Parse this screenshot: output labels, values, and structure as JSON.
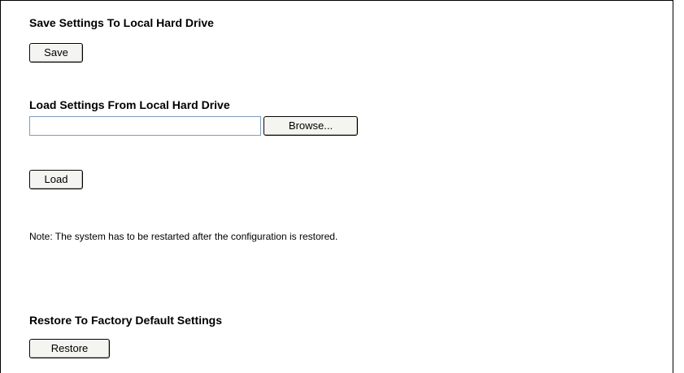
{
  "save_section": {
    "title": "Save Settings To Local Hard Drive",
    "save_button": "Save"
  },
  "load_section": {
    "title": "Load Settings From Local Hard Drive",
    "file_value": "",
    "browse_button": "Browse...",
    "load_button": "Load"
  },
  "note": "Note: The system has to be restarted after the configuration is restored.",
  "restore_section": {
    "title": "Restore To Factory Default Settings",
    "restore_button": "Restore"
  }
}
